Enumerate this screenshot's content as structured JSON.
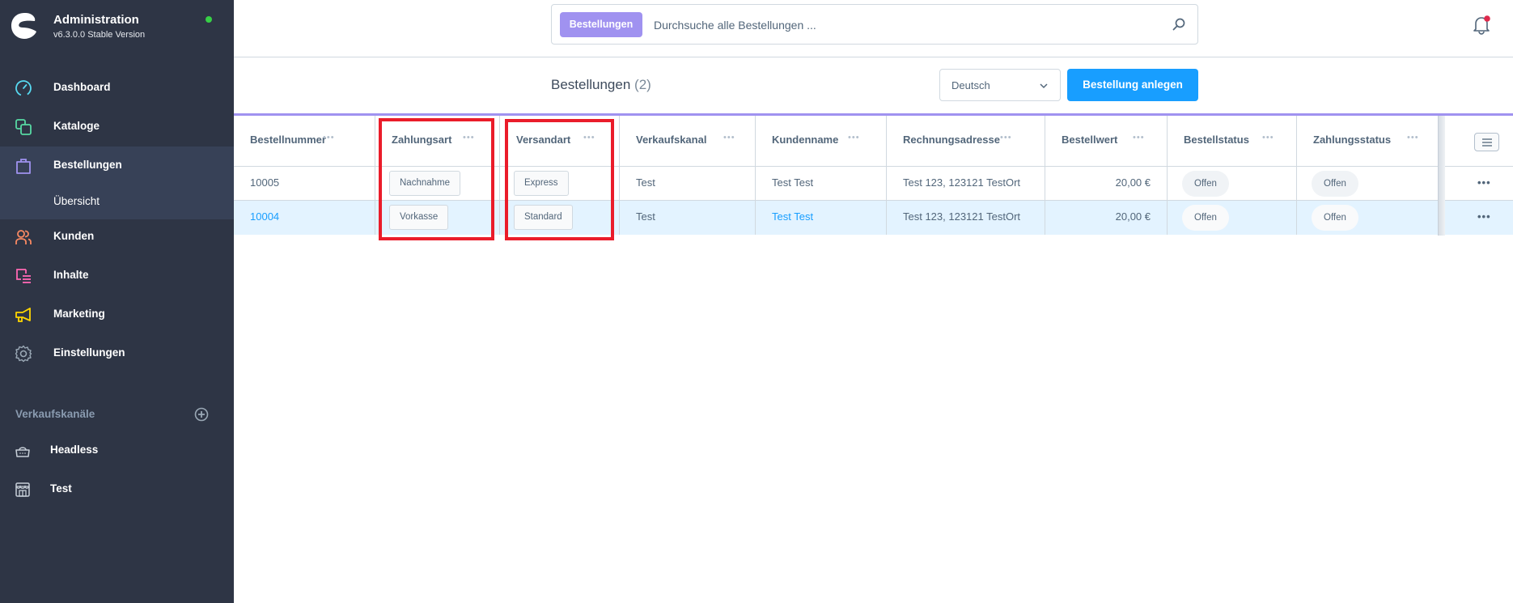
{
  "sidebar": {
    "brand_title": "Administration",
    "brand_version": "v6.3.0.0 Stable Version",
    "status_color": "#37d046",
    "nav": [
      {
        "label": "Dashboard",
        "icon": "dashboard-icon",
        "color": "#57d9f0"
      },
      {
        "label": "Kataloge",
        "icon": "catalog-icon",
        "color": "#57d9a3"
      },
      {
        "label": "Bestellungen",
        "icon": "shopping-bag-icon",
        "color": "#a092f0",
        "active": true
      },
      {
        "label": "Kunden",
        "icon": "customers-icon",
        "color": "#f88962"
      },
      {
        "label": "Inhalte",
        "icon": "content-icon",
        "color": "#ff68b4"
      },
      {
        "label": "Marketing",
        "icon": "megaphone-icon",
        "color": "#ffd700"
      },
      {
        "label": "Einstellungen",
        "icon": "gear-icon",
        "color": "#9aa8b5"
      }
    ],
    "sub_nav": [
      {
        "label": "Übersicht"
      }
    ],
    "channels_title": "Verkaufskanäle",
    "channels": [
      {
        "label": "Headless",
        "icon": "basket-icon"
      },
      {
        "label": "Test",
        "icon": "storefront-icon"
      }
    ]
  },
  "topbar": {
    "search_module": "Bestellungen",
    "search_placeholder": "Durchsuche alle Bestellungen ...",
    "search_value": ""
  },
  "page": {
    "title": "Bestellungen",
    "count": "(2)",
    "language_selected": "Deutsch",
    "create_button": "Bestellung anlegen"
  },
  "table": {
    "columns": [
      "Bestellnummer",
      "Zahlungsart",
      "Versandart",
      "Verkaufskanal",
      "Kundenname",
      "Rechnungsadresse",
      "Bestellwert",
      "Bestellstatus",
      "Zahlungsstatus"
    ],
    "rows": [
      {
        "order_number": "10005",
        "payment_method": "Nachnahme",
        "shipping_method": "Express",
        "sales_channel": "Test",
        "customer_name": "Test Test",
        "billing_address": "Test 123, 123121 TestOrt",
        "order_value": "20,00 €",
        "order_status": "Offen",
        "payment_status": "Offen",
        "actions": "•••"
      },
      {
        "order_number": "10004",
        "payment_method": "Vorkasse",
        "shipping_method": "Standard",
        "sales_channel": "Test",
        "customer_name": "Test Test",
        "billing_address": "Test 123, 123121 TestOrt",
        "order_value": "20,00 €",
        "order_status": "Offen",
        "payment_status": "Offen",
        "actions": "•••",
        "hovered": true
      }
    ],
    "header_dots": "•••"
  },
  "annotations": {
    "highlight_color": "#ea1c2a",
    "highlighted_columns": [
      "Zahlungsart",
      "Versandart"
    ]
  }
}
